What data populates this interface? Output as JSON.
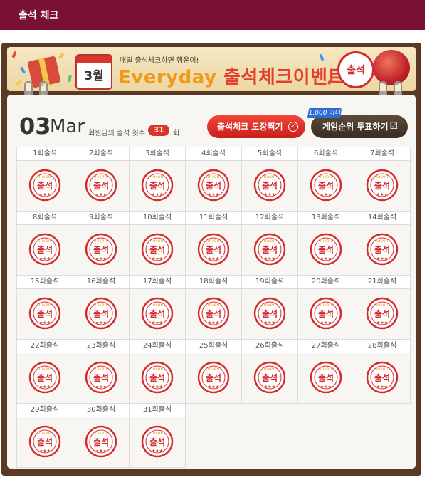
{
  "header": {
    "title": "출석 체크"
  },
  "banner": {
    "month": "3월",
    "subtitle": "매일 출석체크하면 행운이!",
    "title_en": "Everyday",
    "title_ko": "출석체크이벤트",
    "seal_text": "출석"
  },
  "summary": {
    "day": "03",
    "month": "Mar",
    "count_label": "회원님의 출석 횟수",
    "count": "31",
    "count_unit": "회"
  },
  "buttons": {
    "stamp": "출석체크 도장찍기",
    "vote": "게임순위 투표하기",
    "promo_badge": "1,000 이니"
  },
  "stamp": {
    "brand": "inven",
    "text": "출석",
    "color": "#d42c2c"
  },
  "days": [
    "1회출석",
    "2회출석",
    "3회출석",
    "4회출석",
    "5회출석",
    "6회출석",
    "7회출석",
    "8회출석",
    "9회출석",
    "10회출석",
    "11회출석",
    "12회출석",
    "13회출석",
    "14회출석",
    "15회출석",
    "16회출석",
    "17회출석",
    "18회출석",
    "19회출석",
    "20회출석",
    "21회출석",
    "22회출석",
    "23회출석",
    "24회출석",
    "25회출석",
    "26회출석",
    "27회출석",
    "28회출석",
    "29회출석",
    "30회출석",
    "31회출석"
  ],
  "colors": {
    "topbar": "#7a1033",
    "frame": "#5a3a25",
    "accent": "#d8352b"
  }
}
